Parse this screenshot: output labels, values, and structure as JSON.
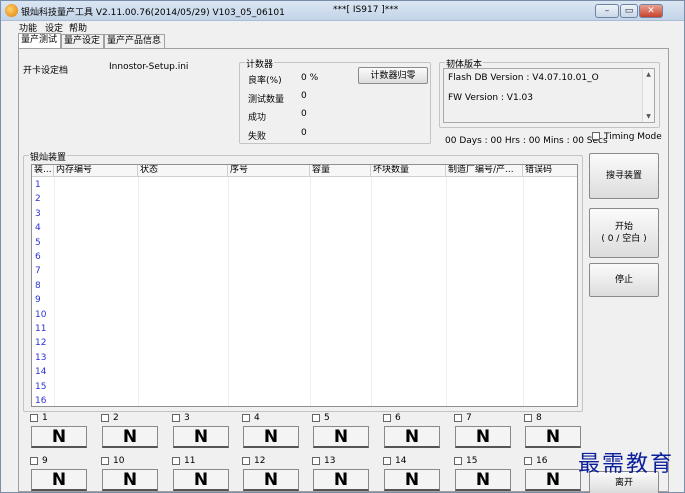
{
  "window": {
    "title": "银灿科技量产工具 V2.11.00.76(2014/05/29)     V103_05_06101",
    "title_mid": "***[ IS917 ]***",
    "buttons": {
      "minimize": "–",
      "maximize": "▭",
      "close": "✕"
    }
  },
  "menu": [
    "功能",
    "设定",
    "帮助"
  ],
  "tabs": [
    "量产测试",
    "量产设定",
    "量产产品信息"
  ],
  "settings": {
    "label": "开卡设定档",
    "value": "Innostor-Setup.ini"
  },
  "counter": {
    "title": "计数器",
    "rows": [
      {
        "label": "良率(%)",
        "value": "0 %"
      },
      {
        "label": "测试数量",
        "value": "0"
      },
      {
        "label": "成功",
        "value": "0"
      },
      {
        "label": "失败",
        "value": "0"
      }
    ],
    "reset_label": "计数器归零"
  },
  "firmware": {
    "title": "韧体版本",
    "flash_db": "Flash DB Version :  V4.07.10.01_O",
    "fw": "FW Version :   V1.03",
    "timer": "00 Days : 00 Hrs : 00 Mins : 00 Secs",
    "timing_mode": "Timing Mode"
  },
  "device_group": {
    "title": "银灿装置",
    "columns": [
      "装...",
      "内存编号",
      "状态",
      "序号",
      "容量",
      "坏块数量",
      "制造厂编号/产...",
      "错误码"
    ],
    "rows": [
      "1",
      "2",
      "3",
      "4",
      "5",
      "6",
      "7",
      "8",
      "9",
      "10",
      "11",
      "12",
      "13",
      "14",
      "15",
      "16"
    ]
  },
  "actions": {
    "search": "搜寻装置",
    "start_line1": "开始",
    "start_line2": "( 0 / 空白 )",
    "stop": "停止",
    "exit": "离开"
  },
  "ports": [
    {
      "label": "1",
      "state": "N"
    },
    {
      "label": "2",
      "state": "N"
    },
    {
      "label": "3",
      "state": "N"
    },
    {
      "label": "4",
      "state": "N"
    },
    {
      "label": "5",
      "state": "N"
    },
    {
      "label": "6",
      "state": "N"
    },
    {
      "label": "7",
      "state": "N"
    },
    {
      "label": "8",
      "state": "N"
    },
    {
      "label": "9",
      "state": "N"
    },
    {
      "label": "10",
      "state": "N"
    },
    {
      "label": "11",
      "state": "N"
    },
    {
      "label": "12",
      "state": "N"
    },
    {
      "label": "13",
      "state": "N"
    },
    {
      "label": "14",
      "state": "N"
    },
    {
      "label": "15",
      "state": "N"
    },
    {
      "label": "16",
      "state": "N"
    }
  ],
  "watermark": "最需教育",
  "colors": {
    "row_number": "#2a32d8",
    "watermark": "#0b1f9a",
    "close_button": "#c7422a"
  }
}
